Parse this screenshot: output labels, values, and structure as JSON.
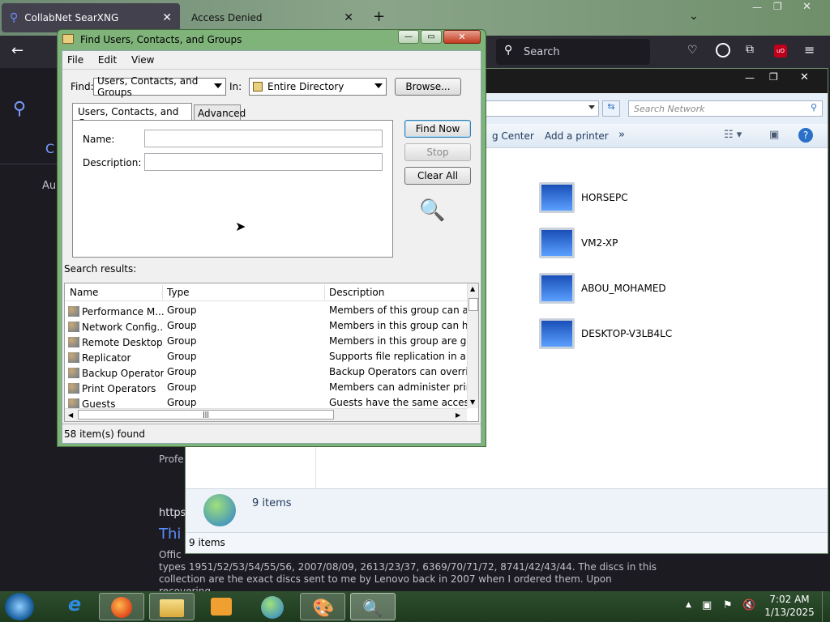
{
  "browser": {
    "tabs": [
      {
        "label": "CollabNet SearXNG",
        "active": true
      },
      {
        "label": "Access Denied",
        "active": false
      }
    ],
    "new_tab": "+",
    "search_placeholder": "Search",
    "page": {
      "partial_text_1": "Au",
      "partial_text_2": "Profe",
      "partial_url": "https",
      "partial_heading": "Thi",
      "description_lines": [
        "Offic",
        "types 1951/52/53/54/55/56, 2007/08/09, 2613/23/37, 6369/70/71/72, 8741/42/43/44. The discs in this",
        "collection are the exact discs sent to me by Lenovo back in 2007 when I ordered them. Upon recovering"
      ]
    }
  },
  "explorer": {
    "search_placeholder": "Search Network",
    "toolbar": [
      "g Center",
      "Add a printer",
      "»"
    ],
    "computers": [
      "HORSEPC",
      "VM2-XP",
      "ABOU_MOHAMED",
      "DESKTOP-V3LB4LC"
    ],
    "details_count": "9 items",
    "status": "9 items"
  },
  "dialog": {
    "title": "Find Users, Contacts, and Groups",
    "menu": [
      "File",
      "Edit",
      "View"
    ],
    "find_label": "Find:",
    "find_value": "Users, Contacts, and Groups",
    "in_label": "In:",
    "in_value": "Entire Directory",
    "browse": "Browse...",
    "tabs": [
      "Users, Contacts, and Groups",
      "Advanced"
    ],
    "name_label": "Name:",
    "description_label": "Description:",
    "find_now": "Find Now",
    "stop": "Stop",
    "clear_all": "Clear All",
    "search_results_label": "Search results:",
    "columns": [
      "Name",
      "Type",
      "Description"
    ],
    "rows": [
      [
        "Performance M...",
        "Group",
        "Members of this group can acce"
      ],
      [
        "Network Config...",
        "Group",
        "Members in this group can have"
      ],
      [
        "Remote Desktop...",
        "Group",
        "Members in this group are grant"
      ],
      [
        "Replicator",
        "Group",
        "Supports file replication in a dor"
      ],
      [
        "Backup Operators",
        "Group",
        "Backup Operators can override s"
      ],
      [
        "Print Operators",
        "Group",
        "Members can administer printer"
      ],
      [
        "Guests",
        "Group",
        "Guests have the same access as"
      ]
    ],
    "status": "58 item(s) found"
  },
  "taskbar": {
    "time": "7:02 AM",
    "date": "1/13/2025"
  }
}
